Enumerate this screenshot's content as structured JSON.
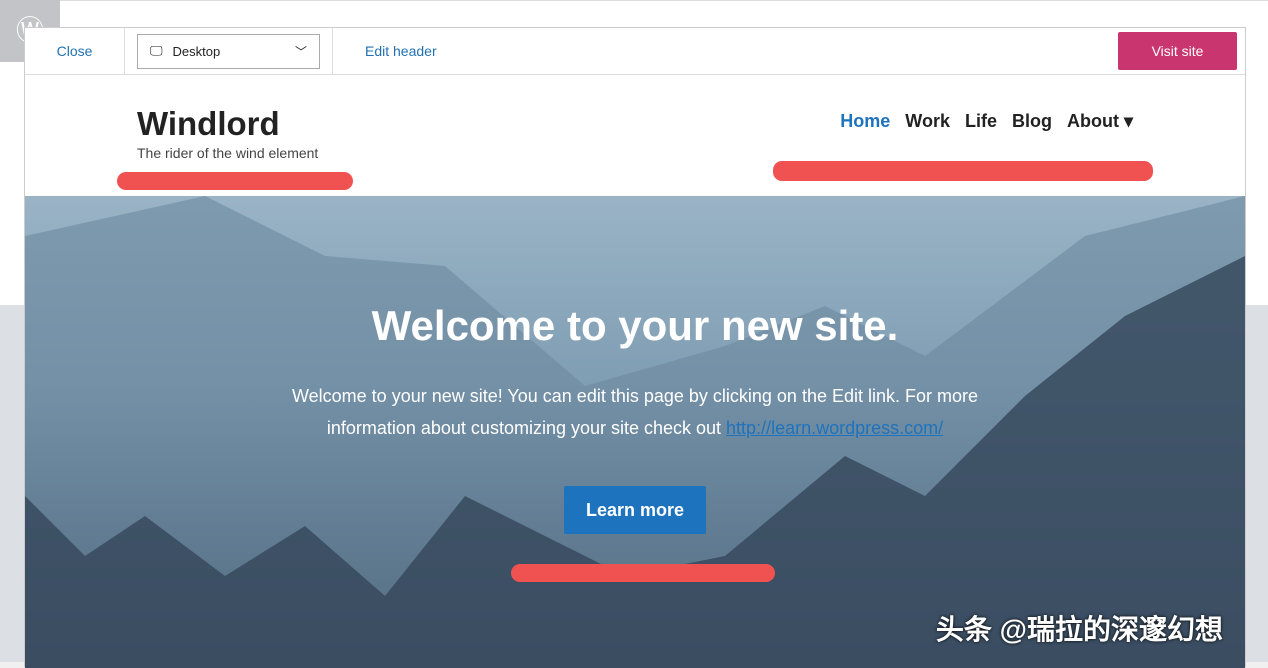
{
  "toolbar": {
    "close": "Close",
    "device": "Desktop",
    "edit_header": "Edit header",
    "visit_site": "Visit site"
  },
  "site": {
    "title": "Windlord",
    "tagline": "The rider of the wind element",
    "nav": [
      {
        "label": "Home",
        "active": true
      },
      {
        "label": "Work"
      },
      {
        "label": "Life"
      },
      {
        "label": "Blog"
      },
      {
        "label": "About ▾"
      }
    ]
  },
  "hero": {
    "heading": "Welcome to your new site.",
    "text": "Welcome to your new site! You can edit this page by clicking on the Edit link. For more information about customizing your site check out ",
    "link": "http://learn.wordpress.com/",
    "button": "Learn more"
  },
  "watermark": "头条 @瑞拉的深邃幻想",
  "colors": {
    "accent": "#2271b1",
    "visit": "#c9356e",
    "highlight": "#f05252"
  }
}
